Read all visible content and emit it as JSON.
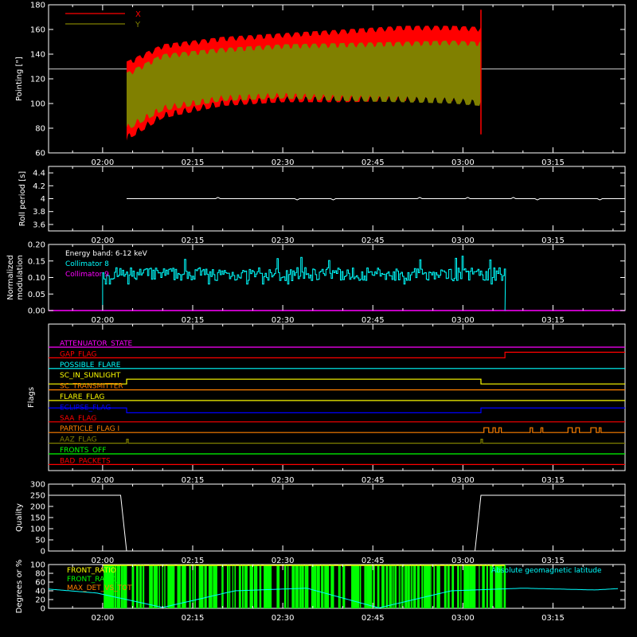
{
  "chart_data": [
    {
      "type": "line",
      "id": "pointing",
      "ylabel": "Pointing [\"]",
      "ylim": [
        60,
        180
      ],
      "yticks": [
        60,
        80,
        100,
        120,
        140,
        160,
        180
      ],
      "xticks": [
        "02:00",
        "02:15",
        "02:30",
        "02:45",
        "03:00",
        "03:15"
      ],
      "legend": [
        {
          "name": "X",
          "color": "#ff0000"
        },
        {
          "name": "Y",
          "color": "#808000"
        }
      ],
      "reference_line": 128,
      "series": [
        {
          "name": "X",
          "color": "#ff0000",
          "envelope_time": [
            "02:04",
            "02:10",
            "02:20",
            "02:30",
            "02:40",
            "02:50",
            "02:58",
            "03:03"
          ],
          "upper": [
            134,
            148,
            154,
            157,
            160,
            163,
            163,
            162
          ],
          "lower": [
            70,
            88,
            98,
            101,
            101,
            102,
            102,
            100
          ]
        },
        {
          "name": "Y",
          "color": "#808000",
          "envelope_time": [
            "02:04",
            "02:10",
            "02:20",
            "02:30",
            "02:40",
            "02:50",
            "02:58",
            "03:03"
          ],
          "upper": [
            125,
            140,
            145,
            148,
            149,
            150,
            151,
            150
          ],
          "lower": [
            78,
            94,
            102,
            104,
            102,
            101,
            100,
            98
          ]
        }
      ]
    },
    {
      "type": "line",
      "id": "roll",
      "ylabel": "Roll period [s]",
      "ylim": [
        3.5,
        4.5
      ],
      "yticks": [
        3.6,
        3.8,
        4.0,
        4.2,
        4.4
      ],
      "xticks": [
        "02:00",
        "02:15",
        "02:30",
        "02:45",
        "03:00",
        "03:15"
      ],
      "series": [
        {
          "name": "roll period",
          "color": "#ffffff",
          "value": 4.0,
          "time_range": [
            "02:04",
            "03:27"
          ]
        }
      ]
    },
    {
      "type": "line",
      "id": "modulation",
      "ylabel": "Normalized modulation",
      "ylim": [
        0.0,
        0.2
      ],
      "yticks": [
        "0.00",
        "0.05",
        "0.10",
        "0.15",
        "0.20"
      ],
      "xticks": [
        "02:00",
        "02:15",
        "02:30",
        "02:45",
        "03:00",
        "03:15"
      ],
      "annotation": "Energy band: 6-12 keV",
      "legend": [
        {
          "name": "Collimator 8",
          "color": "#00ffff"
        },
        {
          "name": "Collimator 9",
          "color": "#ff00ff"
        }
      ],
      "series": [
        {
          "name": "Collimator 8",
          "color": "#00ffff",
          "time_range": [
            "02:00",
            "03:07"
          ],
          "mean": 0.11,
          "min": 0.08,
          "max": 0.17
        },
        {
          "name": "Collimator 9",
          "color": "#ff00ff",
          "value": 0.0
        }
      ]
    },
    {
      "type": "line",
      "id": "flags",
      "ylabel": "Flags",
      "xticks": [
        "02:00",
        "02:15",
        "02:30",
        "02:45",
        "03:00",
        "03:15"
      ],
      "series": [
        {
          "name": "ATTENUATOR_STATE",
          "color": "#ff00ff"
        },
        {
          "name": "GAP_FLAG",
          "color": "#ff0000"
        },
        {
          "name": "POSSIBLE_FLARE",
          "color": "#00ffff"
        },
        {
          "name": "SC_IN_SUNLIGHT",
          "color": "#ffff00"
        },
        {
          "name": "SC_TRANSMITTER",
          "color": "#ff8000"
        },
        {
          "name": "FLARE_FLAG",
          "color": "#ffff00"
        },
        {
          "name": "ECLIPSE_FLAG",
          "color": "#0000ff"
        },
        {
          "name": "SAA_FLAG",
          "color": "#ff0000"
        },
        {
          "name": "PARTICLE_FLAG I",
          "color": "#ff8000"
        },
        {
          "name": "AAZ_FLAG",
          "color": "#808000"
        },
        {
          "name": "FRONTS_OFF",
          "color": "#00ff00"
        },
        {
          "name": "BAD_PACKETS",
          "color": "#ff0000"
        }
      ]
    },
    {
      "type": "line",
      "id": "quality",
      "ylabel": "Quality",
      "ylim": [
        0,
        300
      ],
      "yticks": [
        0,
        50,
        100,
        150,
        200,
        250,
        300
      ],
      "xticks": [
        "02:00",
        "02:15",
        "02:30",
        "02:45",
        "03:00",
        "03:15"
      ],
      "series": [
        {
          "name": "quality",
          "color": "#ffffff",
          "segments": [
            {
              "time": [
                "01:51",
                "02:03"
              ],
              "value": 250
            },
            {
              "time": [
                "02:04",
                "03:02"
              ],
              "value": 0
            },
            {
              "time": [
                "03:03",
                "03:27"
              ],
              "value": 250
            }
          ]
        }
      ]
    },
    {
      "type": "line",
      "id": "geomag",
      "ylabel": "Degrees or %",
      "ylim": [
        0,
        100
      ],
      "yticks": [
        0,
        20,
        40,
        60,
        80,
        100
      ],
      "xticks": [
        "02:00",
        "02:15",
        "02:30",
        "02:45",
        "03:00",
        "03:15"
      ],
      "legend": [
        {
          "name": "FRONT_RATIO",
          "color": "#ffff00"
        },
        {
          "name": "FRONT_RATIO_",
          "color": "#00ff00"
        },
        {
          "name": "MAX_DET_VS_TOT",
          "color": "#ff8000"
        },
        {
          "name": "Absolute geomagnetic latitude",
          "color": "#00ffff"
        }
      ],
      "series": [
        {
          "name": "Absolute geomagnetic latitude",
          "color": "#00ffff",
          "x": [
            "01:51",
            "01:59",
            "02:10",
            "02:22",
            "02:34",
            "02:46",
            "02:58",
            "03:10",
            "03:22",
            "03:27"
          ],
          "y": [
            44,
            35,
            2,
            40,
            46,
            1,
            40,
            46,
            42,
            46
          ]
        },
        {
          "name": "FRONT_RATIO_",
          "color": "#00ff00",
          "time_range": [
            "02:00",
            "03:07"
          ],
          "value_range": [
            0,
            100
          ]
        }
      ]
    }
  ]
}
